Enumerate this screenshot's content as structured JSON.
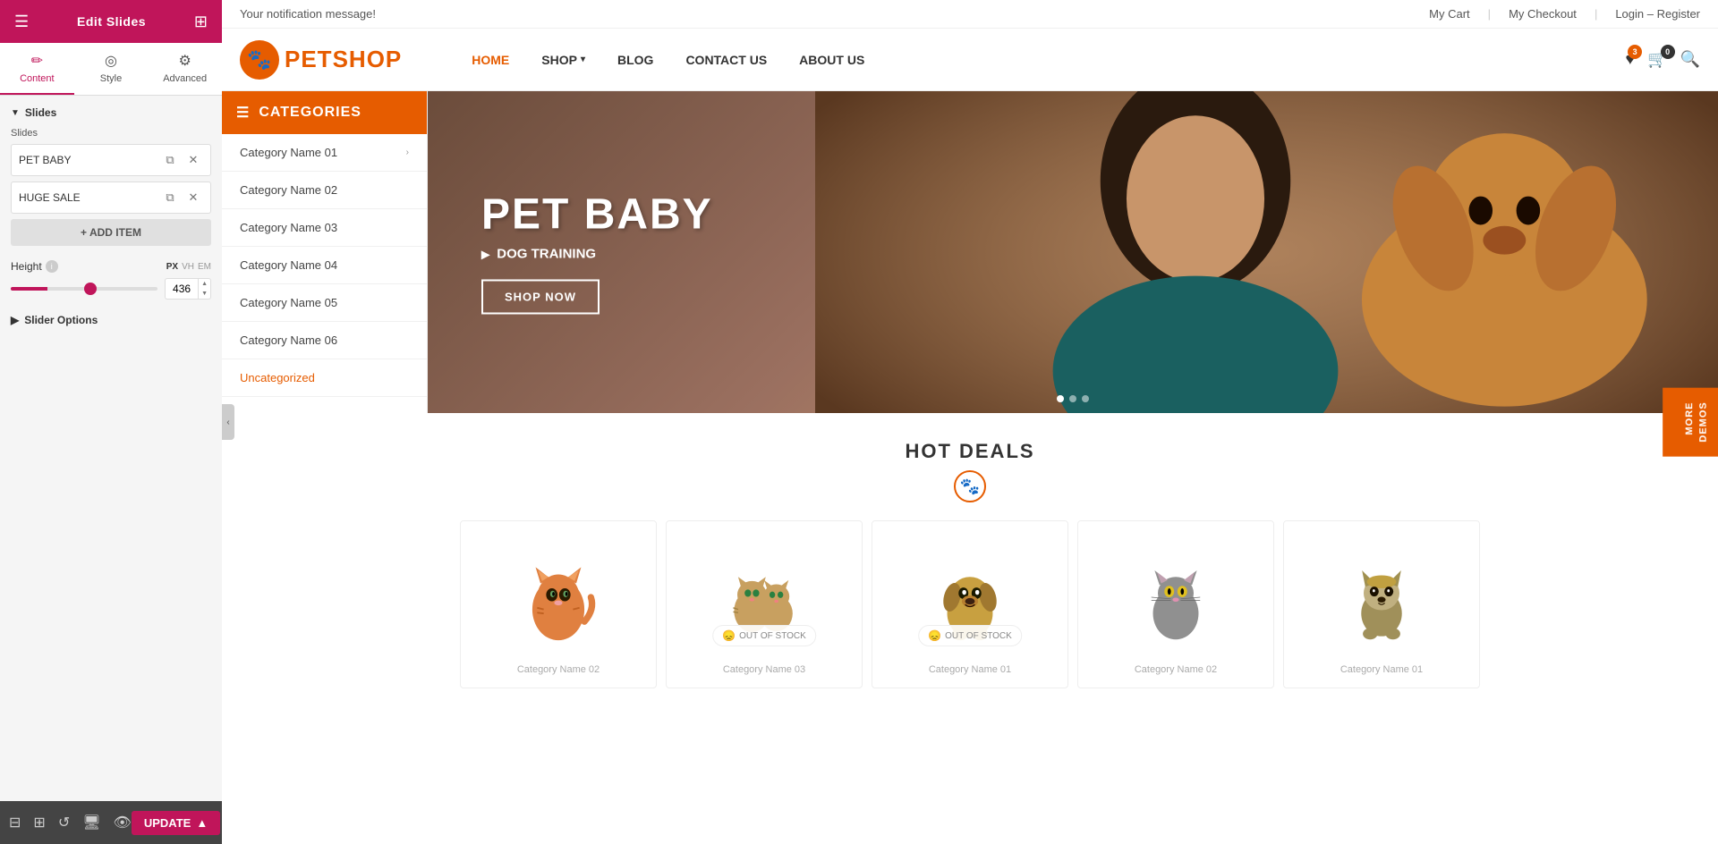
{
  "panel": {
    "title": "Edit Slides",
    "tabs": [
      {
        "label": "Content",
        "icon": "✏️",
        "active": true
      },
      {
        "label": "Style",
        "icon": "⚙️",
        "active": false
      },
      {
        "label": "Advanced",
        "icon": "⚙️",
        "active": false
      }
    ],
    "slides_label": "Slides",
    "slides": [
      {
        "name": "PET BABY"
      },
      {
        "name": "HUGE SALE"
      }
    ],
    "add_item_label": "+ ADD ITEM",
    "height_label": "Height",
    "height_units": [
      "PX",
      "VH",
      "EM"
    ],
    "height_value": "436",
    "slider_options_label": "Slider Options",
    "update_label": "UPDATE"
  },
  "notification_bar": {
    "message": "Your notification message!",
    "links": [
      "My Cart",
      "My Checkout",
      "Login – Register"
    ]
  },
  "nav": {
    "logo_text_part1": "PET",
    "logo_text_part2": "SHOP",
    "links": [
      "HOME",
      "SHOP",
      "BLOG",
      "CONTACT US",
      "ABOUT US"
    ],
    "active_link": "HOME",
    "cart_count": "0",
    "wishlist_count": "3"
  },
  "categories": {
    "header": "CATEGORIES",
    "items": [
      {
        "name": "Category Name 01",
        "has_submenu": true
      },
      {
        "name": "Category Name 02",
        "has_submenu": false
      },
      {
        "name": "Category Name 03",
        "has_submenu": false
      },
      {
        "name": "Category Name 04",
        "has_submenu": false
      },
      {
        "name": "Category Name 05",
        "has_submenu": false
      },
      {
        "name": "Category Name 06",
        "has_submenu": false
      },
      {
        "name": "Uncategorized",
        "has_submenu": false
      }
    ]
  },
  "hero": {
    "subtitle": "PET BABY",
    "title": "PET BABY",
    "sub2": "DOG TRAINING",
    "shop_btn": "SHOP NOW",
    "dots": [
      true,
      false,
      false
    ]
  },
  "more_demos": {
    "label": "MORE\nDEMOS"
  },
  "hot_deals": {
    "title": "HOT DEALS",
    "products": [
      {
        "category": "Category Name 02",
        "out_of_stock": false,
        "animal": "orange-cat"
      },
      {
        "category": "Category Name 03",
        "out_of_stock": true,
        "animal": "kittens"
      },
      {
        "category": "Category Name 01",
        "out_of_stock": true,
        "animal": "puppy"
      },
      {
        "category": "Category Name 02",
        "out_of_stock": false,
        "animal": "gray-cat"
      },
      {
        "category": "Category Name 01",
        "out_of_stock": false,
        "animal": "terrier"
      }
    ],
    "out_of_stock_label": "OUT OF STOCK"
  }
}
